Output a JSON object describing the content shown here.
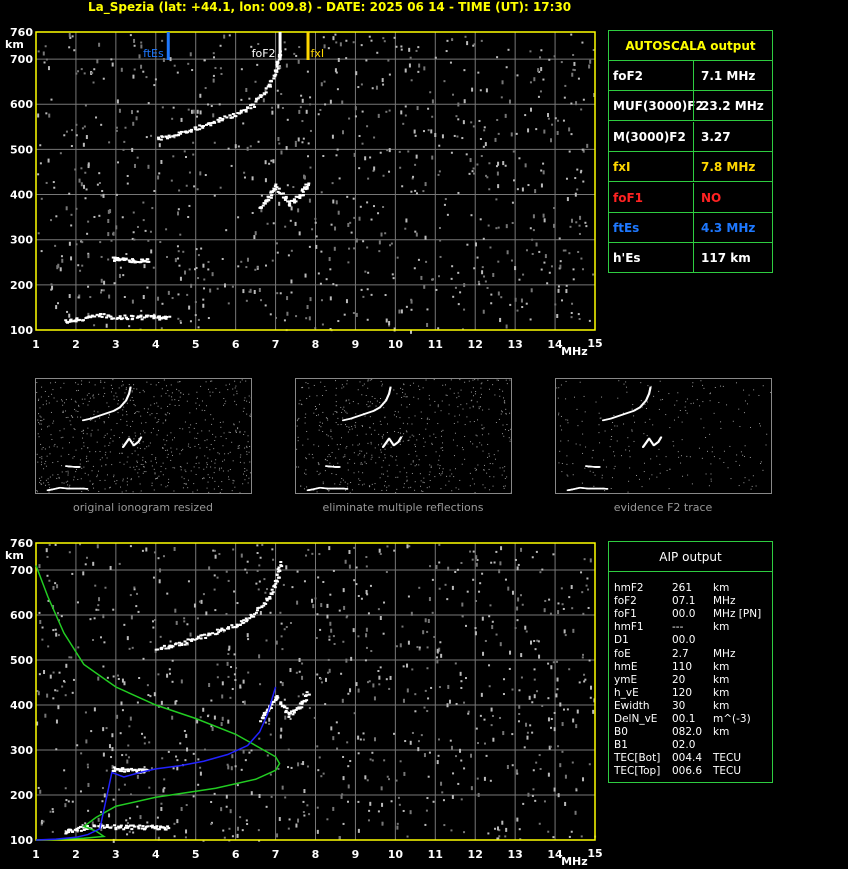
{
  "title": "La_Spezia (lat: +44.1, lon: 009.8) - DATE: 2025 06 14 - TIME (UT): 17:30",
  "colors": {
    "grid": "#777777",
    "frame": "#ffff00",
    "fes": "#1e78ff",
    "fxi": "#ffd700",
    "profile": "#22cc22",
    "trace": "#2222ff",
    "panel_border": "#2ecc40"
  },
  "chart_data": [
    {
      "type": "scatter",
      "name": "main-ionogram",
      "x_unit": "MHz",
      "y_unit": "km",
      "xlim": [
        1,
        15
      ],
      "ylim": [
        100,
        760
      ],
      "x_ticks": [
        "1",
        "2",
        "3",
        "4",
        "5",
        "6",
        "7",
        "8",
        "9",
        "10",
        "11",
        "12",
        "13",
        "14",
        "15"
      ],
      "y_ticks": [
        "100",
        "200",
        "300",
        "400",
        "500",
        "600",
        "700",
        "760"
      ],
      "grid": true,
      "markers": [
        {
          "label": "ftEs",
          "x": 4.3,
          "color": "#1e78ff"
        },
        {
          "label": "foF2",
          "x": 7.1,
          "color": "#ffffff"
        },
        {
          "label": "fxI",
          "x": 7.8,
          "color": "#ffd700"
        }
      ],
      "traces": [
        {
          "name": "F2 o-mode",
          "points": [
            [
              4.0,
              525
            ],
            [
              4.5,
              535
            ],
            [
              5.0,
              550
            ],
            [
              5.5,
              565
            ],
            [
              6.0,
              580
            ],
            [
              6.4,
              600
            ],
            [
              6.8,
              640
            ],
            [
              7.0,
              680
            ],
            [
              7.1,
              720
            ]
          ]
        },
        {
          "name": "F2 x-mode",
          "points": [
            [
              6.6,
              370
            ],
            [
              6.8,
              395
            ],
            [
              7.0,
              420
            ],
            [
              7.3,
              380
            ],
            [
              7.6,
              400
            ],
            [
              7.8,
              430
            ]
          ]
        },
        {
          "name": "Es",
          "points": [
            [
              1.7,
              120
            ],
            [
              2.0,
              125
            ],
            [
              2.5,
              135
            ],
            [
              3.0,
              130
            ],
            [
              3.5,
              130
            ],
            [
              4.0,
              130
            ],
            [
              4.3,
              128
            ]
          ]
        },
        {
          "name": "2Es",
          "points": [
            [
              2.9,
              260
            ],
            [
              3.1,
              258
            ],
            [
              3.5,
              255
            ],
            [
              3.8,
              255
            ]
          ]
        }
      ]
    },
    {
      "type": "line",
      "name": "aip-ionogram",
      "x_unit": "MHz",
      "y_unit": "km",
      "xlim": [
        1,
        15
      ],
      "ylim": [
        100,
        760
      ],
      "x_ticks": [
        "1",
        "2",
        "3",
        "4",
        "5",
        "6",
        "7",
        "8",
        "9",
        "10",
        "11",
        "12",
        "13",
        "14",
        "15"
      ],
      "y_ticks": [
        "100",
        "200",
        "300",
        "400",
        "500",
        "600",
        "700",
        "760"
      ],
      "grid": true,
      "series": [
        {
          "color": "#22cc22",
          "x": [
            1.0,
            1.3,
            1.7,
            2.2,
            3.0,
            4.0,
            5.0,
            6.0,
            6.6,
            7.0,
            7.1,
            7.0,
            6.5,
            5.5,
            4.0,
            3.0,
            2.5,
            2.2,
            2.5,
            2.7,
            2.2,
            1.5,
            1.0
          ],
          "y": [
            710,
            640,
            560,
            490,
            440,
            400,
            370,
            335,
            305,
            285,
            270,
            255,
            235,
            215,
            195,
            175,
            150,
            130,
            120,
            108,
            104,
            101,
            100
          ]
        },
        {
          "color": "#2222ff",
          "x": [
            1.0,
            1.5,
            2.0,
            2.3,
            2.6,
            2.9,
            3.2,
            3.6,
            4.0,
            4.6,
            5.2,
            5.8,
            6.3,
            6.6,
            6.8,
            7.0
          ],
          "y": [
            100,
            102,
            106,
            112,
            125,
            250,
            240,
            250,
            258,
            265,
            275,
            290,
            310,
            340,
            380,
            440
          ]
        }
      ]
    },
    {
      "type": "scatter",
      "name": "thumbnails",
      "captions": [
        "original ionogram resized",
        "eliminate multiple reflections",
        "evidence F2 trace"
      ]
    }
  ],
  "autoscala": {
    "title": "AUTOSCALA output",
    "rows": [
      {
        "label": "foF2",
        "value": "7.1 MHz",
        "color": "#ffffff"
      },
      {
        "label": "MUF(3000)F2",
        "value": "23.2 MHz",
        "color": "#ffffff"
      },
      {
        "label": "M(3000)F2",
        "value": "3.27",
        "color": "#ffffff"
      },
      {
        "label": "fxI",
        "value": "7.8 MHz",
        "color": "#ffd700"
      },
      {
        "label": "foF1",
        "value": "NO",
        "color": "#ff2222"
      },
      {
        "label": "ftEs",
        "value": "4.3 MHz",
        "color": "#1e78ff"
      },
      {
        "label": "h'Es",
        "value": "117     km",
        "color": "#ffffff"
      }
    ]
  },
  "aip": {
    "title": "AIP output",
    "rows": [
      {
        "p": "hmF2",
        "v": "261",
        "u": "km"
      },
      {
        "p": "foF2",
        "v": "07.1",
        "u": "MHz"
      },
      {
        "p": "foF1",
        "v": "00.0",
        "u": "MHz   [PN]"
      },
      {
        "p": "hmF1",
        "v": "---",
        "u": "km"
      },
      {
        "p": "D1",
        "v": "00.0",
        "u": ""
      },
      {
        "p": "foE",
        "v": "2.7",
        "u": "MHz"
      },
      {
        "p": "hmE",
        "v": "110",
        "u": "km"
      },
      {
        "p": "ymE",
        "v": "20",
        "u": "km"
      },
      {
        "p": "h_vE",
        "v": "120",
        "u": "km"
      },
      {
        "p": "Ewidth",
        "v": "30",
        "u": "km"
      },
      {
        "p": "DelN_vE",
        "v": "00.1",
        "u": "m^(-3)"
      },
      {
        "p": "B0",
        "v": "082.0",
        "u": "km"
      },
      {
        "p": "B1",
        "v": "02.0",
        "u": ""
      },
      {
        "p": "TEC[Bot]",
        "v": "004.4",
        "u": "TECU"
      },
      {
        "p": "TEC[Top]",
        "v": "006.6",
        "u": "TECU"
      }
    ]
  },
  "units": {
    "km": "km",
    "mhz": "MHz"
  }
}
